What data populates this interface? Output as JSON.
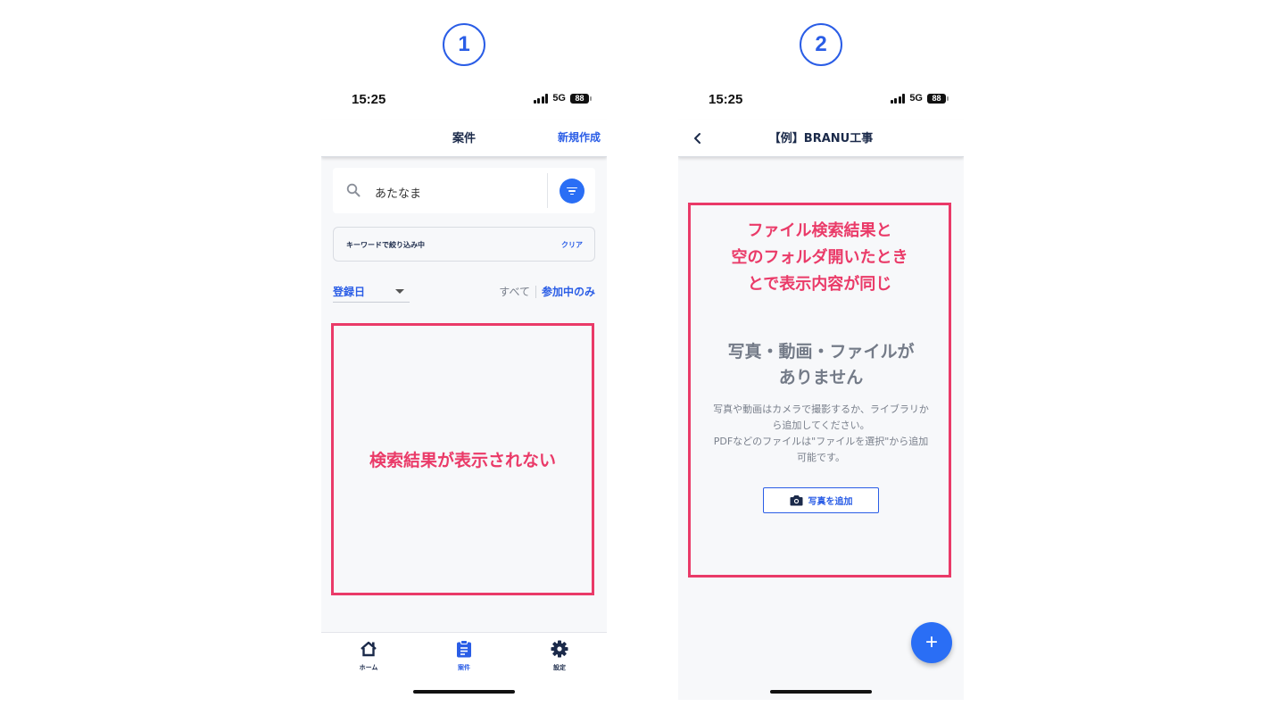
{
  "steps": {
    "left": "1",
    "right": "2"
  },
  "status": {
    "time": "15:25",
    "network": "5G",
    "battery": "88"
  },
  "screen1": {
    "nav": {
      "title": "案件",
      "action": "新規作成"
    },
    "search": {
      "value": "あたなま"
    },
    "keyword_chip": {
      "text": "キーワードで絞り込み中",
      "clear": "クリア"
    },
    "sort": {
      "selected": "登録日"
    },
    "segment": {
      "all": "すべて",
      "mine": "参加中のみ"
    },
    "annotation": "検索結果が表示されない",
    "tabs": [
      {
        "label": "ホーム",
        "icon": "home-icon"
      },
      {
        "label": "案件",
        "icon": "clipboard-icon"
      },
      {
        "label": "設定",
        "icon": "gear-icon"
      }
    ]
  },
  "screen2": {
    "nav": {
      "title": "【例】BRANU工事"
    },
    "annotation_lines": [
      "ファイル検索結果と",
      "空のフォルダ開いたとき",
      "とで表示内容が同じ"
    ],
    "empty": {
      "title_lines": [
        "写真・動画・ファイルが",
        "ありません"
      ],
      "desc_lines": [
        "写真や動画はカメラで撮影するか、ライブラリか",
        "ら追加してください。",
        "PDFなどのファイルは\"ファイルを選択\"から追加",
        "可能です。"
      ],
      "button": "写真を追加"
    },
    "fab": "+"
  },
  "colors": {
    "accent": "#2a5de6",
    "annotation": "#ea3a68",
    "navy": "#1b2a4a"
  }
}
